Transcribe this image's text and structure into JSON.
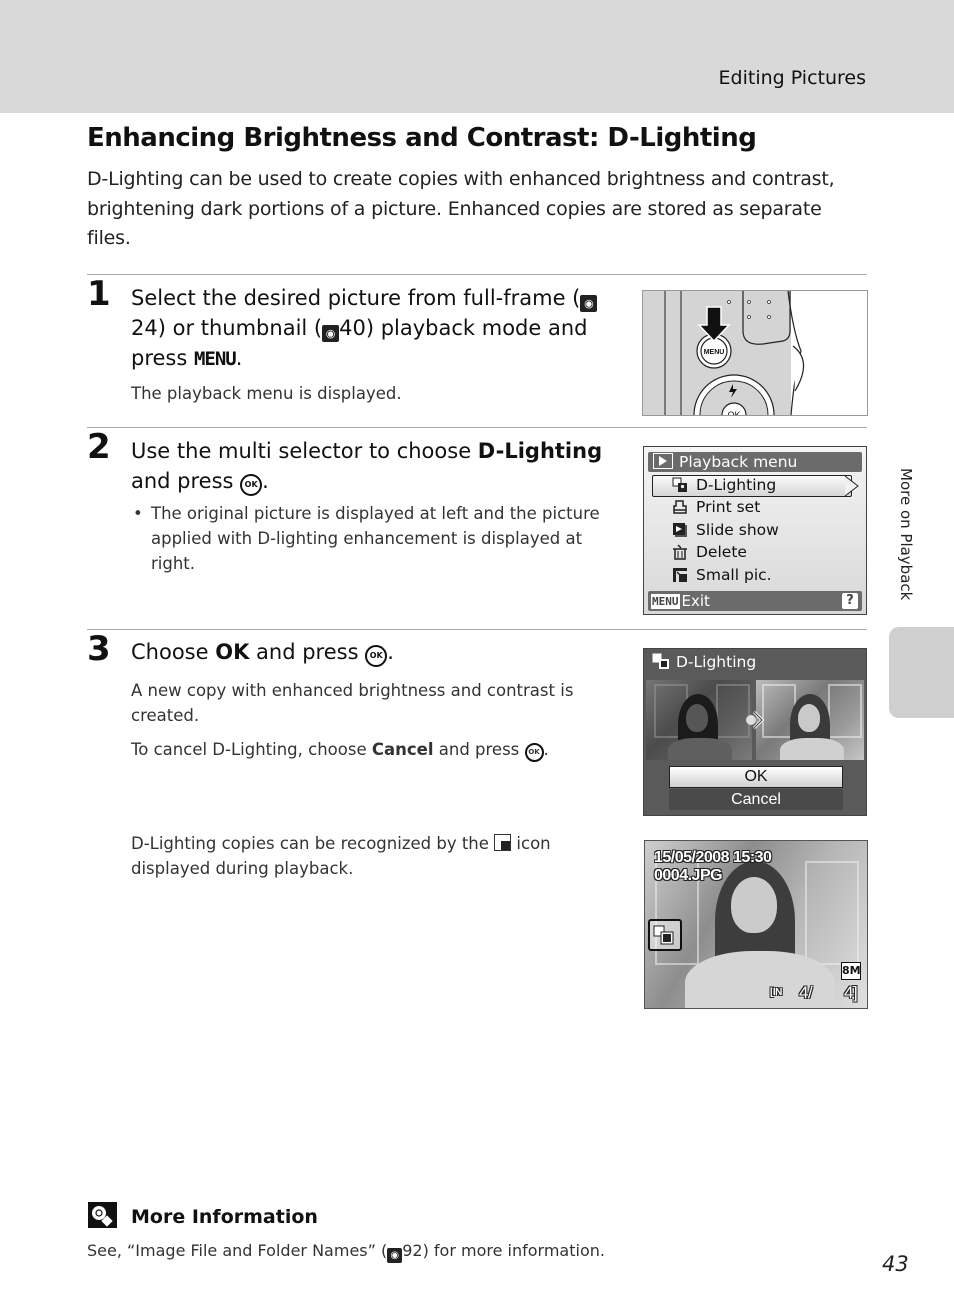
{
  "header": {
    "section_title": "Editing Pictures"
  },
  "page_title": "Enhancing Brightness and Contrast: D-Lighting",
  "intro": "D-Lighting can be used to create copies with enhanced brightness and contrast, brightening dark portions of a picture. Enhanced copies are stored as separate files.",
  "steps": [
    {
      "number": "1",
      "heading_parts": [
        "Select the desired picture from full-frame (",
        "24) or thumbnail (",
        "40) playback mode and press ",
        "MENU",
        "."
      ],
      "ref_icon": "reference-icon",
      "body": "The playback menu is displayed.",
      "illustration": {
        "button_label": "MENU",
        "ok_label": "OK"
      }
    },
    {
      "number": "2",
      "heading_parts": [
        "Use the multi selector to choose ",
        "D-Lighting",
        " and press ",
        "."
      ],
      "bullet": "The original picture is displayed at left and the picture applied with D-lighting enhancement is displayed at right.",
      "screen": {
        "title": "Playback menu",
        "items": [
          {
            "label": "D-Lighting",
            "icon": "d-lighting-icon",
            "selected": true
          },
          {
            "label": "Print set",
            "icon": "print-set-icon",
            "selected": false
          },
          {
            "label": "Slide show",
            "icon": "slide-show-icon",
            "selected": false
          },
          {
            "label": "Delete",
            "icon": "delete-icon",
            "selected": false
          },
          {
            "label": "Small pic.",
            "icon": "small-pic-icon",
            "selected": false
          }
        ],
        "footer_menu": "MENU",
        "footer_label": "Exit",
        "help": "?"
      }
    },
    {
      "number": "3",
      "heading_parts": [
        "Choose ",
        "OK",
        " and press ",
        "."
      ],
      "body1": "A new copy with enhanced brightness and contrast is created.",
      "body2_parts": [
        "To cancel D-Lighting, choose ",
        "Cancel",
        " and press ",
        "."
      ],
      "screen": {
        "title": "D-Lighting",
        "ok": "OK",
        "cancel": "Cancel"
      }
    }
  ],
  "note": {
    "parts": [
      "D-Lighting copies can be recognized by the ",
      " icon displayed during playback."
    ],
    "playback": {
      "datetime": "15/05/2008 15:30",
      "filename": "0004.JPG",
      "size": "8M",
      "memory": "IN",
      "counter": "4/",
      "total": "4"
    }
  },
  "side_tab": "More on Playback",
  "more_info": {
    "title": "More Information",
    "text_parts": [
      "See, “Image File and Folder Names” (",
      "92) for more information."
    ]
  },
  "ok_glyph": "OK",
  "page_number": "43"
}
